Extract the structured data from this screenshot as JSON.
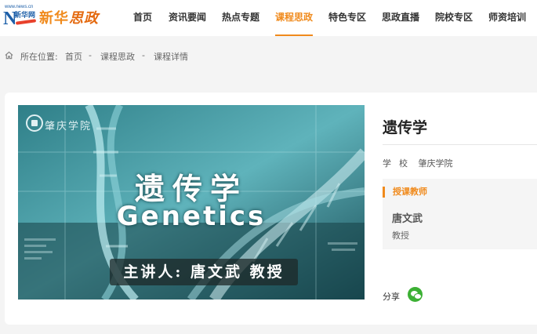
{
  "header": {
    "logo_small": "www.news.cn",
    "logo_letter": "N",
    "logo_xinhua": "新华网",
    "logo_title_a": "新华",
    "logo_title_b": "思政",
    "nav": [
      {
        "label": "首页",
        "active": false
      },
      {
        "label": "资讯要闻",
        "active": false
      },
      {
        "label": "热点专题",
        "active": false
      },
      {
        "label": "课程思政",
        "active": true
      },
      {
        "label": "特色专区",
        "active": false
      },
      {
        "label": "思政直播",
        "active": false
      },
      {
        "label": "院校专区",
        "active": false
      },
      {
        "label": "师资培训",
        "active": false
      }
    ],
    "accent_color": "#f08a1c"
  },
  "breadcrumb": {
    "prefix": "所在位置:",
    "items": [
      "首页",
      "课程思政",
      "课程详情"
    ],
    "separator": "-"
  },
  "course": {
    "banner": {
      "school": "肇庆学院",
      "title_cn": "遗传学",
      "title_en": "Genetics",
      "speaker": "主讲人: 唐文武 教授"
    },
    "title": "遗传学",
    "school_label": "学校",
    "school_value": "肇庆学院",
    "teacher_heading": "授课教师",
    "teacher_name": "唐文武",
    "teacher_title": "教授",
    "share_label": "分享",
    "share_icon": "wechat-icon"
  }
}
